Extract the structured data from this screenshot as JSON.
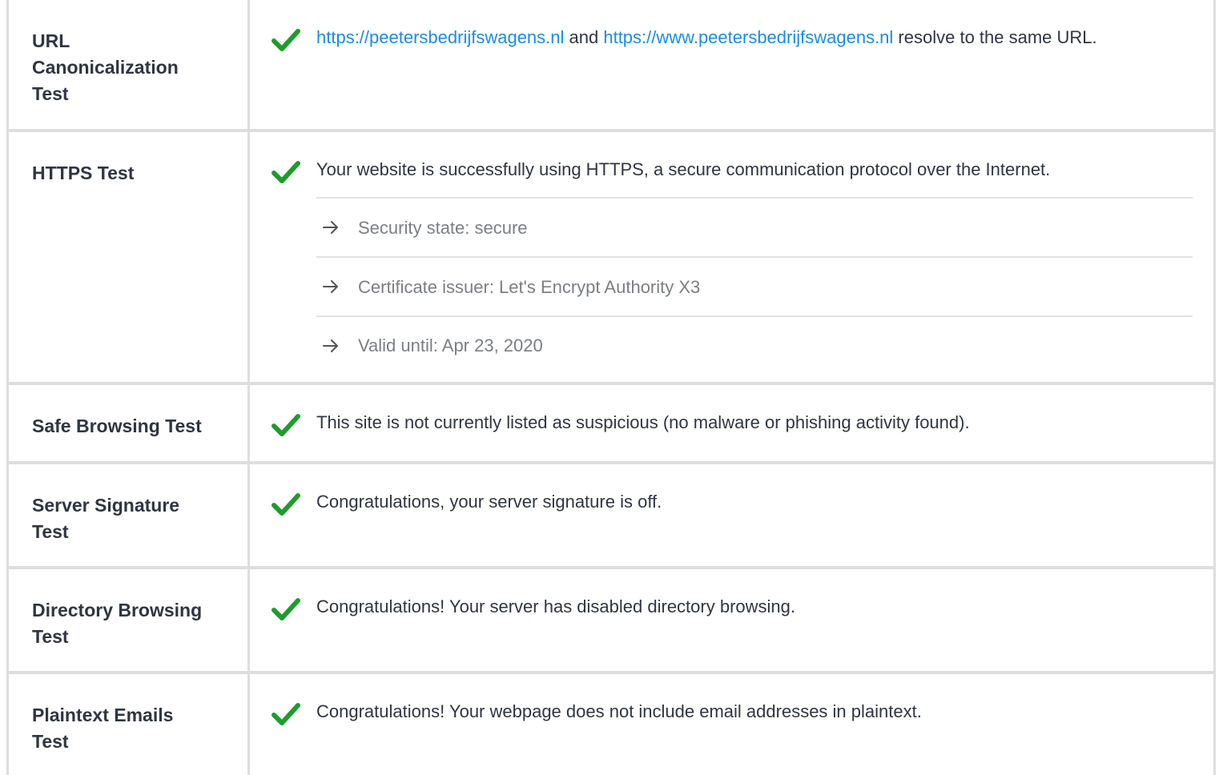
{
  "rows": [
    {
      "label": "URL Canonicalization Test",
      "status": "pass",
      "link1": "https://peetersbedrijfswagens.nl",
      "connector": " and ",
      "link2": "https://www.peetersbedrijfswagens.nl",
      "suffix": " resolve to the same URL."
    },
    {
      "label": "HTTPS Test",
      "status": "pass",
      "text": "Your website is successfully using HTTPS, a secure communication protocol over the Internet.",
      "details": [
        "Security state: secure",
        "Certificate issuer: Let's Encrypt Authority X3",
        "Valid until: Apr 23, 2020"
      ]
    },
    {
      "label": "Safe Browsing Test",
      "status": "pass",
      "text": "This site is not currently listed as suspicious (no malware or phishing activity found)."
    },
    {
      "label": "Server Signature Test",
      "status": "pass",
      "text": "Congratulations, your server signature is off."
    },
    {
      "label": "Directory Browsing Test",
      "status": "pass",
      "text": "Congratulations! Your server has disabled directory browsing."
    },
    {
      "label": "Plaintext Emails Test",
      "status": "pass",
      "text": "Congratulations! Your webpage does not include email addresses in plaintext."
    }
  ],
  "colors": {
    "check": "#1e9c2b",
    "link": "#1b8ce8",
    "text": "#2f3542",
    "muted": "#7b7f85",
    "border": "#dedede"
  },
  "icons": {
    "status": "check-icon",
    "detail": "arrow-right-icon"
  }
}
